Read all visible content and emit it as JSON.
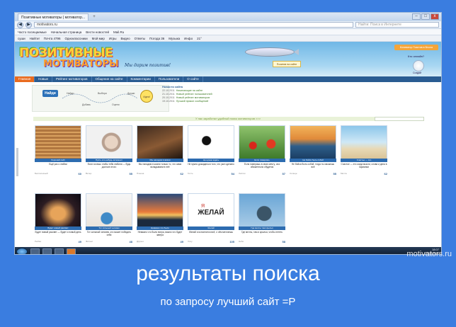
{
  "browser": {
    "tab_label": "Позитивные мотиваторы | мотиватор...",
    "tab_new": "+",
    "url": "motivators.ru",
    "search_placeholder": "Найти: Поиск в Интернете",
    "back": "◀",
    "forward": "▶",
    "min": "–",
    "max": "□",
    "close": "x"
  },
  "bookmarks": [
    "Часто посещаемые",
    "Начальная страница",
    "Вести новостей",
    "Mail.Ru"
  ],
  "toolbar2": [
    "суши",
    "Найти!",
    "Почта 4796",
    "Одноклассники",
    "Мой мир",
    "Игры",
    "Видео",
    "Ответы",
    "Погода 36",
    "Музыка",
    "Инфо",
    "21°"
  ],
  "site": {
    "logo_top": "ПОЗИТИВНЫЕ",
    "logo_bottom": "МОТИВАТОРЫ",
    "slogan": "Мы дарим позитив!",
    "banner": "Позитив на сайте",
    "userbox": "Мотиватор Позитив в блогах",
    "login_label": "Кто онлайн?",
    "create_label": "Создай",
    "menu": [
      "Главная",
      "Новые",
      "Рейтинг мотиваторов",
      "Общение на сайте",
      "Комментарии",
      "Пользователи",
      "О сайте"
    ],
    "promo_button": "Найди",
    "promo_idea": "Идея!",
    "steps": [
      "Найди",
      "Добавь",
      "Выбери",
      "Оцени",
      "Дружи"
    ],
    "news_title": "Новости сайта",
    "news": [
      {
        "date": "22.10.2011",
        "text": "Начинающие на сайте"
      },
      {
        "date": "21.10.2011",
        "text": "Новый рейтинг пользователей"
      },
      {
        "date": "20.10.2011",
        "text": "Новый рейтинг мотиваторов"
      },
      {
        "date": "19.10.2011",
        "text": "Лучший прикол сообщений"
      }
    ],
    "strip_text": "У нас заработал удобный поиск мотиваторов >>>"
  },
  "cards": [
    {
      "caption": "Хороший сайт",
      "title": "Ещё раз о любви",
      "author": "Бесполезный",
      "score": "60"
    },
    {
      "caption": "Пусть кто-нибудь вспомнит",
      "title": "Если хочешь чтобы тебя любили — будь достоин этого",
      "author": "Ветер",
      "score": "55"
    },
    {
      "caption": "Мы находим в жизни",
      "title": "Мы находим в жизни только то, что сами вкладываем в неё",
      "author": "Плюша",
      "score": "62"
    },
    {
      "caption": "Не нужно ждать",
      "title": "Не нужно дожидаться того, что уже сделано",
      "author": "Гость",
      "score": "54"
    },
    {
      "caption": "Если поверишь",
      "title": "Если поверишь в свою мечту, она обязательно сбудется",
      "author": "Листик",
      "score": "57"
    },
    {
      "caption": "Не бойся быть собой",
      "title": "Не бойся быть собой, тогда ты сможешь всё",
      "author": "Солнце",
      "score": "55"
    },
    {
      "caption": "Счастье — это",
      "title": "Счастье — это когда мысли, слова и дела в гармонии",
      "author": "Мечта",
      "score": "62"
    },
    {
      "caption": "Будет новый рассвет",
      "title": "Будет новый рассвет — будет и новый день",
      "author": "Рыбка",
      "score": "49"
    },
    {
      "caption": "Тот сильный человек",
      "title": "Тот сильный человек, кто может победить себя",
      "author": "Фитнес",
      "score": "48"
    },
    {
      "caption": "Неважно что было",
      "title": "Неважно что было вчера, важно что будет завтра",
      "author": "Друзья",
      "score": "49"
    },
    {
      "caption": "Желай",
      "title": "Желай и исполнится всё, о чём мечтаешь",
      "author": "Хочу",
      "score": "105"
    },
    {
      "caption": "Где мечты там крылья",
      "title": "Где мечты, там и крылья, чтобы лететь",
      "author": "Небо",
      "score": "58"
    }
  ],
  "card6_word": "ЖЕЛАЙ",
  "card6_prefix": "Я",
  "taskbar_time": "18:07",
  "taskbar_date": "23.10.2011",
  "watermark": "motivators.ru",
  "headline": "результаты поиска",
  "subline": "по запросу лучший сайт =P"
}
